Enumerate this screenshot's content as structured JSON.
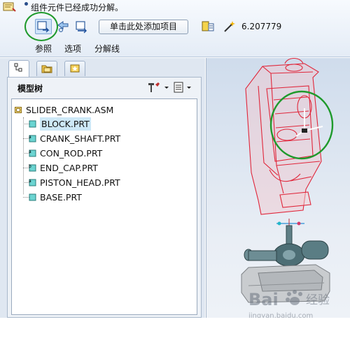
{
  "status": {
    "message": "组件元件已经成功分解。"
  },
  "toolbar": {
    "add_item_label": "单击此处添加项目",
    "value": "6.207779",
    "tabs": [
      "参照",
      "选项",
      "分解线"
    ]
  },
  "model_tree": {
    "title": "模型树",
    "root": "SLIDER_CRANK.ASM",
    "parts": [
      "BLOCK.PRT",
      "CRANK_SHAFT.PRT",
      "CON_ROD.PRT",
      "END_CAP.PRT",
      "PISTON_HEAD.PRT",
      "BASE.PRT"
    ],
    "selected_part": "BLOCK.PRT"
  },
  "colors": {
    "highlight_ring": "#1f9a2c",
    "model_edges": "#e0263a",
    "selection": "#cde8f7",
    "ribbon_bg": "#e4ecf6"
  },
  "watermark": {
    "brand": "Bai",
    "brand_suffix": "经验",
    "url": "jingyan.baidu.com"
  },
  "icons": [
    "status-icon",
    "reference-icon",
    "select-arrow-icon",
    "direction-icon",
    "yellow-grid-icon",
    "magic-wand-icon",
    "tree-tool-icon",
    "tree-columns-icon",
    "assembly-icon",
    "part-icon"
  ]
}
